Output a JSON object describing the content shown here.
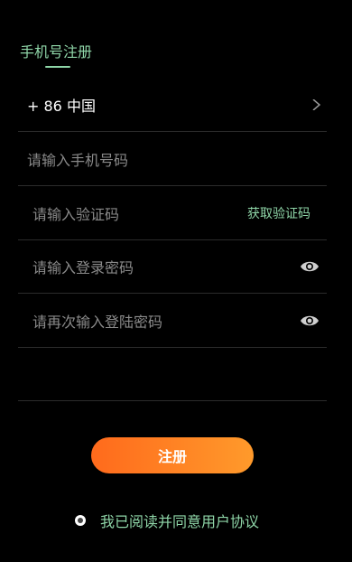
{
  "tab": {
    "label": "手机号注册"
  },
  "country": {
    "code_label": "+ 86 中国"
  },
  "fields": {
    "phone_placeholder": "请输入手机号码",
    "code_placeholder": "请输入验证码",
    "get_code_label": "获取验证码",
    "password_placeholder": "请输入登录密码",
    "confirm_password_placeholder": "请再次输入登陆密码"
  },
  "submit": {
    "label": "注册"
  },
  "agreement": {
    "label": "我已阅读并同意用户协议"
  },
  "colors": {
    "accent": "#8fd6a8",
    "button_start": "#ff6a1c",
    "button_end": "#ff9a2b",
    "background": "#000000"
  },
  "icons": {
    "country_chevron": "chevron-right-icon",
    "password_toggle": "eye-icon"
  }
}
